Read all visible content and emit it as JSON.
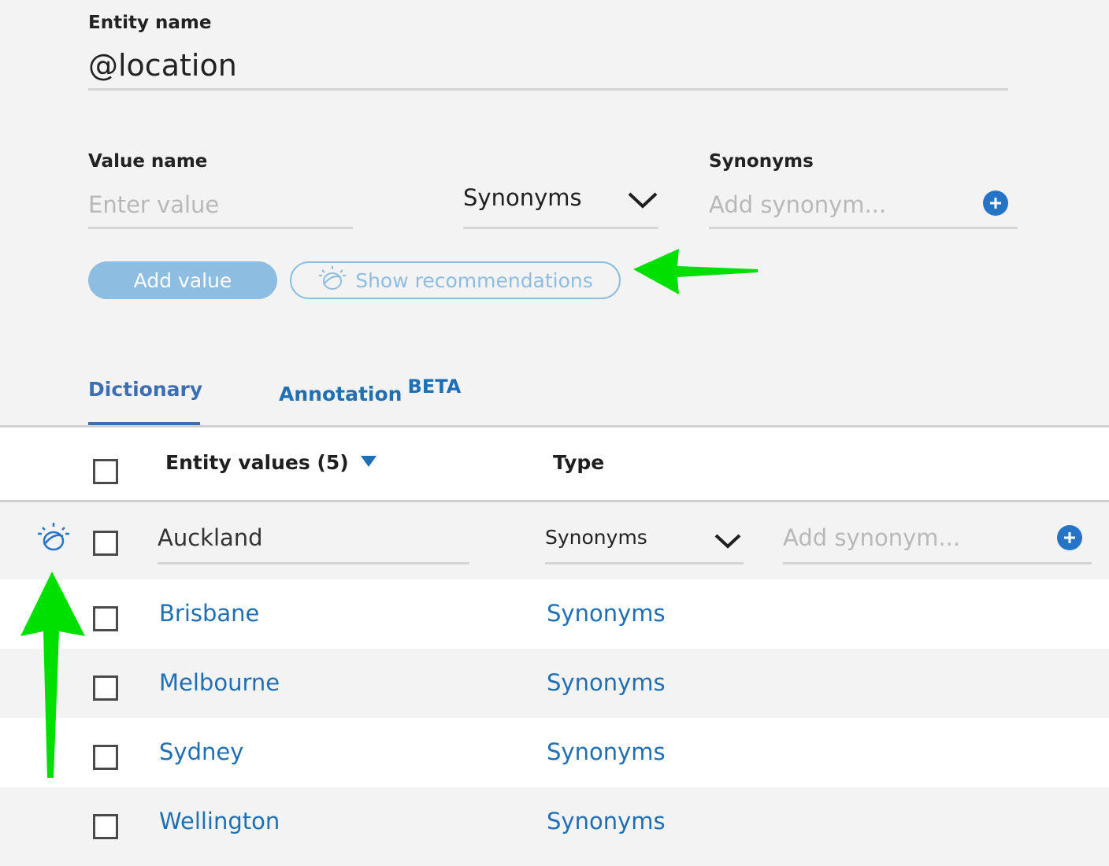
{
  "entity": {
    "label": "Entity name",
    "value": "@location"
  },
  "value_form": {
    "value_name_label": "Value name",
    "value_placeholder": "Enter value",
    "type_selected": "Synonyms",
    "synonyms_label": "Synonyms",
    "synonyms_placeholder": "Add synonym...",
    "add_value_label": "Add value",
    "show_recommendations_label": "Show recommendations"
  },
  "tabs": {
    "dictionary": "Dictionary",
    "annotation": "Annotation",
    "annotation_badge": "BETA"
  },
  "table": {
    "header_values": "Entity values (5)",
    "header_type": "Type",
    "edit_row": {
      "value": "Auckland",
      "type": "Synonyms",
      "synonym_placeholder": "Add synonym..."
    },
    "rows": [
      {
        "value": "Brisbane",
        "type": "Synonyms"
      },
      {
        "value": "Melbourne",
        "type": "Synonyms"
      },
      {
        "value": "Sydney",
        "type": "Synonyms"
      },
      {
        "value": "Wellington",
        "type": "Synonyms"
      }
    ]
  },
  "colors": {
    "accent_blue": "#2574c5",
    "link_blue": "#1f6fb5",
    "button_blue": "#8dbde0",
    "annotation_arrow": "#00e000"
  },
  "icons": [
    "chevron-down-icon",
    "plus-circle-icon",
    "watson-recommendation-icon",
    "sort-desc-icon"
  ]
}
